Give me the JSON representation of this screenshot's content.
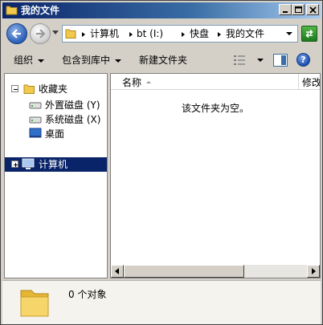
{
  "window": {
    "title": "我的文件",
    "controls": {
      "minimize": "minimize",
      "maximize": "maximize",
      "close": "close"
    }
  },
  "navbar": {
    "breadcrumbs": [
      "计算机",
      "bt (I:)",
      "快盘",
      "我的文件"
    ]
  },
  "toolbar": {
    "organize": "组织",
    "include_in_library": "包含到库中",
    "new_folder": "新建文件夹"
  },
  "nav_pane": {
    "favorites": "收藏夹",
    "items": [
      "外置磁盘 (Y)",
      "系统磁盘 (X)",
      "桌面"
    ],
    "computer": "计算机"
  },
  "content": {
    "columns": [
      "名称",
      "修改"
    ],
    "empty_message": "该文件夹为空。"
  },
  "details": {
    "count_text": "0 个对象"
  },
  "colors": {
    "title_start": "#0a246a",
    "selection": "#0a246a",
    "folder": "#f2c94c"
  }
}
